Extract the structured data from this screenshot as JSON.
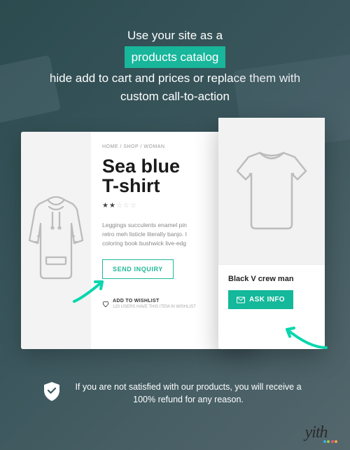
{
  "hero": {
    "line1": "Use your site as a",
    "highlight": "products catalog",
    "line2_a": "hide add to cart and prices or replace them with",
    "line2_b": "custom call-to-action"
  },
  "left_card": {
    "breadcrumb": "HOME / SHOP / WOMAN",
    "title_line1": "Sea blue",
    "title_line2": "T-shirt",
    "rating_filled": "★★",
    "rating_empty": "☆☆☆",
    "desc_line1": "Leggings succulents enamel pin",
    "desc_line2": "retro meh listicle literally banjo. I",
    "desc_line3": "coloring book bushwick live-edg",
    "cta_label": "SEND INQUIRY",
    "wishlist_label": "ADD TO WISHLIST",
    "wishlist_sub": "120 USERS HAVE THIS ITEM IN WISHLIST"
  },
  "right_card": {
    "name": "Black V crew man",
    "cta_label": "ASK INFO"
  },
  "guarantee": {
    "text": "If you are not satisfied with our products, you will receive a 100% refund for any reason."
  },
  "brand": {
    "name": "yith"
  },
  "colors": {
    "accent": "#18b69b",
    "arrow": "#09d6ad"
  }
}
